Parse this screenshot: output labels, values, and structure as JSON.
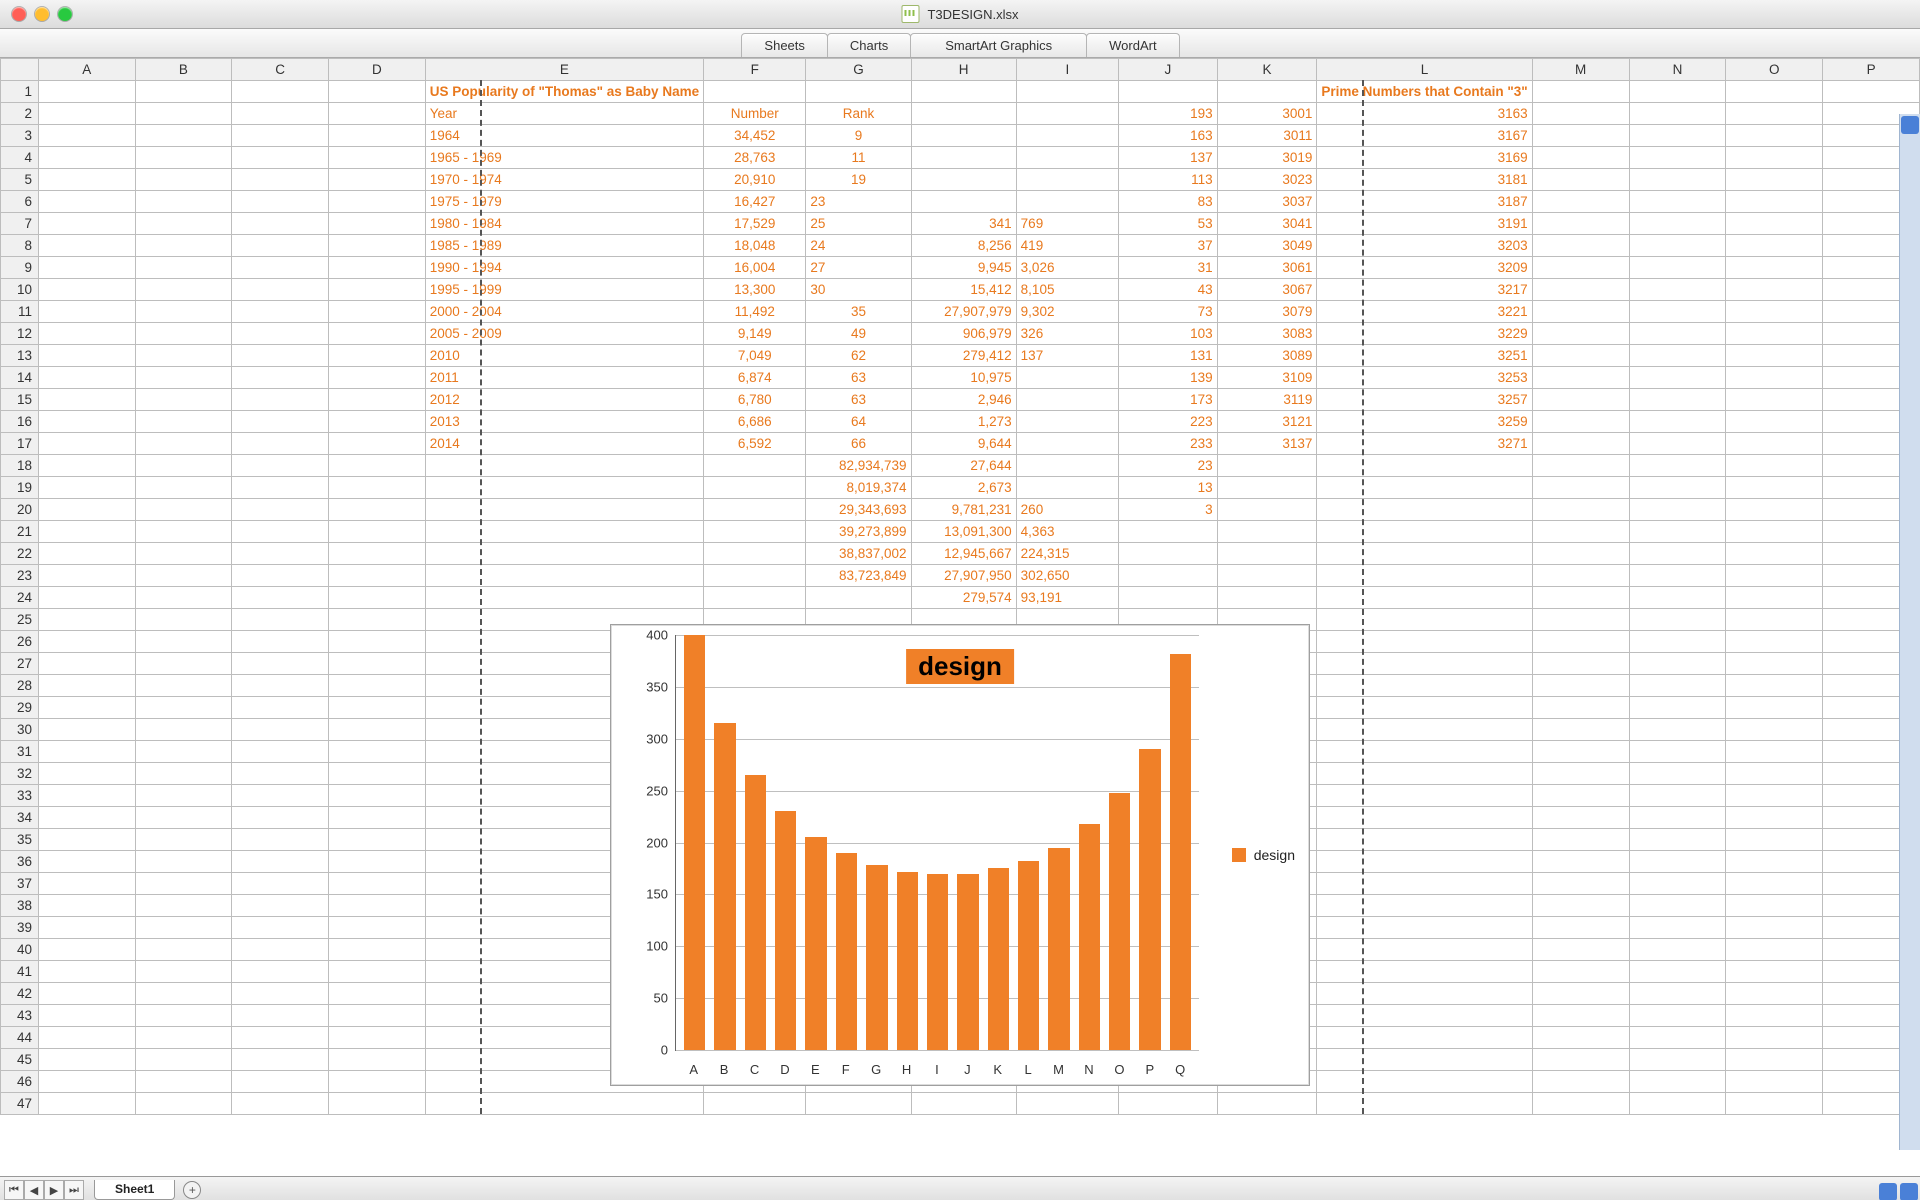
{
  "window": {
    "title": "T3DESIGN.xlsx"
  },
  "ribbon": {
    "tabs": [
      "Sheets",
      "Charts",
      "SmartArt Graphics",
      "WordArt"
    ]
  },
  "sheetstrip": {
    "active": "Sheet1"
  },
  "columns": [
    "A",
    "B",
    "C",
    "D",
    "E",
    "F",
    "G",
    "H",
    "I",
    "J",
    "K",
    "L",
    "M",
    "N",
    "O",
    "P"
  ],
  "row_count": 47,
  "titles": {
    "thomas": "US Popularity of \"Thomas\" as Baby Name",
    "primes": "Prime Numbers that Contain \"3\""
  },
  "thomas_headers": {
    "year": "Year",
    "number": "Number",
    "rank": "Rank"
  },
  "cells": {
    "E2": {
      "v": "Year",
      "a": "left"
    },
    "F2": {
      "v": "Number",
      "a": "center"
    },
    "G2": {
      "v": "Rank",
      "a": "center"
    },
    "E3": {
      "v": "1964",
      "a": "left"
    },
    "F3": {
      "v": "34,452",
      "a": "center"
    },
    "G3": {
      "v": "9",
      "a": "center"
    },
    "E4": {
      "v": "1965 - 1969",
      "a": "left"
    },
    "F4": {
      "v": "28,763",
      "a": "center"
    },
    "G4": {
      "v": "11",
      "a": "center"
    },
    "E5": {
      "v": "1970 - 1974",
      "a": "left"
    },
    "F5": {
      "v": "20,910",
      "a": "center"
    },
    "G5": {
      "v": "19",
      "a": "center"
    },
    "E6": {
      "v": "1975 - 1979",
      "a": "left"
    },
    "F6": {
      "v": "16,427",
      "a": "center"
    },
    "G6": {
      "v": "23",
      "a": "left"
    },
    "E7": {
      "v": "1980 - 1984",
      "a": "left"
    },
    "F7": {
      "v": "17,529",
      "a": "center"
    },
    "G7": {
      "v": "25",
      "a": "left"
    },
    "E8": {
      "v": "1985 - 1989",
      "a": "left"
    },
    "F8": {
      "v": "18,048",
      "a": "center"
    },
    "G8": {
      "v": "24",
      "a": "left"
    },
    "E9": {
      "v": "1990 - 1994",
      "a": "left"
    },
    "F9": {
      "v": "16,004",
      "a": "center"
    },
    "G9": {
      "v": "27",
      "a": "left"
    },
    "E10": {
      "v": "1995 - 1999",
      "a": "left"
    },
    "F10": {
      "v": "13,300",
      "a": "center"
    },
    "G10": {
      "v": "30",
      "a": "left"
    },
    "E11": {
      "v": "2000 - 2004",
      "a": "left"
    },
    "F11": {
      "v": "11,492",
      "a": "center"
    },
    "G11": {
      "v": "35",
      "a": "center"
    },
    "E12": {
      "v": "2005 - 2009",
      "a": "left"
    },
    "F12": {
      "v": "9,149",
      "a": "center"
    },
    "G12": {
      "v": "49",
      "a": "center"
    },
    "E13": {
      "v": "2010",
      "a": "left"
    },
    "F13": {
      "v": "7,049",
      "a": "center"
    },
    "G13": {
      "v": "62",
      "a": "center"
    },
    "E14": {
      "v": "2011",
      "a": "left"
    },
    "F14": {
      "v": "6,874",
      "a": "center"
    },
    "G14": {
      "v": "63",
      "a": "center"
    },
    "E15": {
      "v": "2012",
      "a": "left"
    },
    "F15": {
      "v": "6,780",
      "a": "center"
    },
    "G15": {
      "v": "63",
      "a": "center"
    },
    "E16": {
      "v": "2013",
      "a": "left"
    },
    "F16": {
      "v": "6,686",
      "a": "center"
    },
    "G16": {
      "v": "64",
      "a": "center"
    },
    "E17": {
      "v": "2014",
      "a": "left"
    },
    "F17": {
      "v": "6,592",
      "a": "center"
    },
    "G17": {
      "v": "66",
      "a": "center"
    },
    "G18": {
      "v": "82,934,739",
      "a": "right"
    },
    "H18": {
      "v": "27,644",
      "a": "right"
    },
    "G19": {
      "v": "8,019,374",
      "a": "right"
    },
    "H19": {
      "v": "2,673",
      "a": "right"
    },
    "G20": {
      "v": "29,343,693",
      "a": "right"
    },
    "H20": {
      "v": "9,781,231",
      "a": "right"
    },
    "I20": {
      "v": "260",
      "a": "left"
    },
    "G21": {
      "v": "39,273,899",
      "a": "right"
    },
    "H21": {
      "v": "13,091,300",
      "a": "right"
    },
    "I21": {
      "v": "4,363",
      "a": "left"
    },
    "G22": {
      "v": "38,837,002",
      "a": "right"
    },
    "H22": {
      "v": "12,945,667",
      "a": "right"
    },
    "I22": {
      "v": "224,315",
      "a": "left"
    },
    "G23": {
      "v": "83,723,849",
      "a": "right"
    },
    "H23": {
      "v": "27,907,950",
      "a": "right"
    },
    "I23": {
      "v": "302,650",
      "a": "left"
    },
    "H24": {
      "v": "279,574",
      "a": "right"
    },
    "I24": {
      "v": "93,191",
      "a": "left"
    },
    "H7": {
      "v": "341",
      "a": "right"
    },
    "I7": {
      "v": "769",
      "a": "left"
    },
    "H8": {
      "v": "8,256",
      "a": "right"
    },
    "I8": {
      "v": "419",
      "a": "left"
    },
    "H9": {
      "v": "9,945",
      "a": "right"
    },
    "I9": {
      "v": "3,026",
      "a": "left"
    },
    "H10": {
      "v": "15,412",
      "a": "right"
    },
    "I10": {
      "v": "8,105",
      "a": "left"
    },
    "H11": {
      "v": "27,907,979",
      "a": "right"
    },
    "I11": {
      "v": "9,302",
      "a": "left"
    },
    "H12": {
      "v": "906,979",
      "a": "right"
    },
    "I12": {
      "v": "326",
      "a": "left"
    },
    "H13": {
      "v": "279,412",
      "a": "right"
    },
    "I13": {
      "v": "137",
      "a": "left"
    },
    "H14": {
      "v": "10,975",
      "a": "right"
    },
    "H15": {
      "v": "2,946",
      "a": "right"
    },
    "H16": {
      "v": "1,273",
      "a": "right"
    },
    "H17": {
      "v": "9,644",
      "a": "right"
    },
    "J2": {
      "v": "193",
      "a": "right"
    },
    "K2": {
      "v": "3001",
      "a": "right"
    },
    "L2": {
      "v": "3163",
      "a": "right"
    },
    "J3": {
      "v": "163",
      "a": "right"
    },
    "K3": {
      "v": "3011",
      "a": "right"
    },
    "L3": {
      "v": "3167",
      "a": "right"
    },
    "J4": {
      "v": "137",
      "a": "right"
    },
    "K4": {
      "v": "3019",
      "a": "right"
    },
    "L4": {
      "v": "3169",
      "a": "right"
    },
    "J5": {
      "v": "113",
      "a": "right"
    },
    "K5": {
      "v": "3023",
      "a": "right"
    },
    "L5": {
      "v": "3181",
      "a": "right"
    },
    "J6": {
      "v": "83",
      "a": "right"
    },
    "K6": {
      "v": "3037",
      "a": "right"
    },
    "L6": {
      "v": "3187",
      "a": "right"
    },
    "J7": {
      "v": "53",
      "a": "right"
    },
    "K7": {
      "v": "3041",
      "a": "right"
    },
    "L7": {
      "v": "3191",
      "a": "right"
    },
    "J8": {
      "v": "37",
      "a": "right"
    },
    "K8": {
      "v": "3049",
      "a": "right"
    },
    "L8": {
      "v": "3203",
      "a": "right"
    },
    "J9": {
      "v": "31",
      "a": "right"
    },
    "K9": {
      "v": "3061",
      "a": "right"
    },
    "L9": {
      "v": "3209",
      "a": "right"
    },
    "J10": {
      "v": "43",
      "a": "right"
    },
    "K10": {
      "v": "3067",
      "a": "right"
    },
    "L10": {
      "v": "3217",
      "a": "right"
    },
    "J11": {
      "v": "73",
      "a": "right"
    },
    "K11": {
      "v": "3079",
      "a": "right"
    },
    "L11": {
      "v": "3221",
      "a": "right"
    },
    "J12": {
      "v": "103",
      "a": "right"
    },
    "K12": {
      "v": "3083",
      "a": "right"
    },
    "L12": {
      "v": "3229",
      "a": "right"
    },
    "J13": {
      "v": "131",
      "a": "right"
    },
    "K13": {
      "v": "3089",
      "a": "right"
    },
    "L13": {
      "v": "3251",
      "a": "right"
    },
    "J14": {
      "v": "139",
      "a": "right"
    },
    "K14": {
      "v": "3109",
      "a": "right"
    },
    "L14": {
      "v": "3253",
      "a": "right"
    },
    "J15": {
      "v": "173",
      "a": "right"
    },
    "K15": {
      "v": "3119",
      "a": "right"
    },
    "L15": {
      "v": "3257",
      "a": "right"
    },
    "J16": {
      "v": "223",
      "a": "right"
    },
    "K16": {
      "v": "3121",
      "a": "right"
    },
    "L16": {
      "v": "3259",
      "a": "right"
    },
    "J17": {
      "v": "233",
      "a": "right"
    },
    "K17": {
      "v": "3137",
      "a": "right"
    },
    "L17": {
      "v": "3271",
      "a": "right"
    },
    "J18": {
      "v": "23",
      "a": "right"
    },
    "J19": {
      "v": "13",
      "a": "right"
    },
    "J20": {
      "v": "3",
      "a": "right"
    }
  },
  "chart_data": {
    "type": "bar",
    "title": "design",
    "legend": "design",
    "categories": [
      "A",
      "B",
      "C",
      "D",
      "E",
      "F",
      "G",
      "H",
      "I",
      "J",
      "K",
      "L",
      "M",
      "N",
      "O",
      "P",
      "Q"
    ],
    "values": [
      400,
      315,
      265,
      230,
      205,
      190,
      178,
      172,
      170,
      170,
      175,
      182,
      195,
      218,
      248,
      290,
      382
    ],
    "ylim": [
      0,
      400
    ],
    "yticks": [
      0,
      50,
      100,
      150,
      200,
      250,
      300,
      350,
      400
    ],
    "xlabel": "",
    "ylabel": ""
  }
}
